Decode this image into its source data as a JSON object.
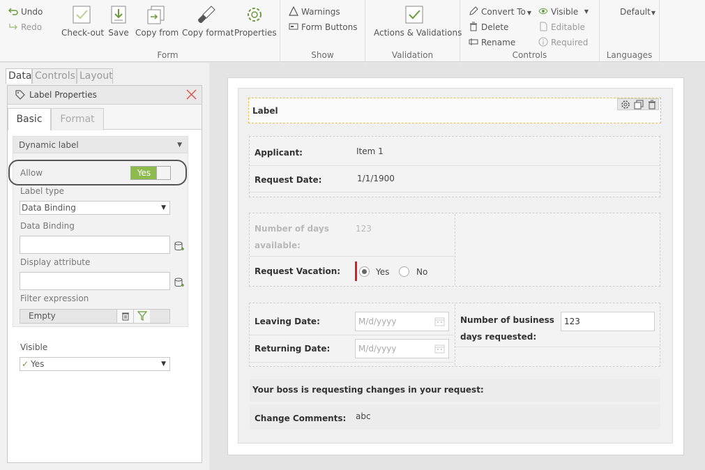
{
  "ribbon": {
    "undo": "Undo",
    "redo": "Redo",
    "form": {
      "label": "Form",
      "checkout": "Check-out",
      "save": "Save",
      "copy_from": "Copy from",
      "copy_format": "Copy format",
      "properties": "Properties"
    },
    "show": {
      "label": "Show",
      "warnings": "Warnings",
      "form_buttons": "Form Buttons"
    },
    "validation": {
      "label": "Validation",
      "actions": "Actions & Validations"
    },
    "controls": {
      "label": "Controls",
      "convert_to": "Convert To",
      "delete": "Delete",
      "rename": "Rename",
      "visible": "Visible",
      "editable": "Editable",
      "required": "Required"
    },
    "languages": {
      "label": "Languages",
      "default": "Default"
    }
  },
  "panel_tabs": [
    "Data",
    "Controls",
    "Layout"
  ],
  "properties": {
    "title": "Label Properties",
    "tabs": [
      "Basic",
      "Format"
    ],
    "section": "Dynamic label",
    "allow_label": "Allow",
    "allow_value": "Yes",
    "label_type_label": "Label type",
    "label_type_value": "Data Binding",
    "data_binding_label": "Data Binding",
    "display_attribute_label": "Display attribute",
    "filter_label": "Filter expression",
    "filter_value": "Empty",
    "visible_label": "Visible",
    "visible_value": "Yes"
  },
  "form": {
    "label_control": "Label",
    "applicant_label": "Applicant:",
    "applicant_value": "Item 1",
    "request_date_label": "Request Date:",
    "request_date_value": "1/1/1900",
    "days_available_label_1": "Number of days",
    "days_available_label_2": "available:",
    "days_available_value": "123",
    "request_vacation_label": "Request Vacation:",
    "yes": "Yes",
    "no": "No",
    "leaving_date_label": "Leaving Date:",
    "returning_date_label": "Returning Date:",
    "date_placeholder": "M/d/yyyy",
    "business_days_label_1": "Number of business",
    "business_days_label_2": "days requested:",
    "business_days_value": "123",
    "boss_message": "Your boss is requesting changes in your request:",
    "change_comments_label": "Change Comments:",
    "change_comments_value": "abc"
  },
  "colors": {
    "toggle_on": "#8dbb4d",
    "required_bar": "#d62020",
    "selection_border": "#e2be55",
    "close_x": "#e05252"
  }
}
